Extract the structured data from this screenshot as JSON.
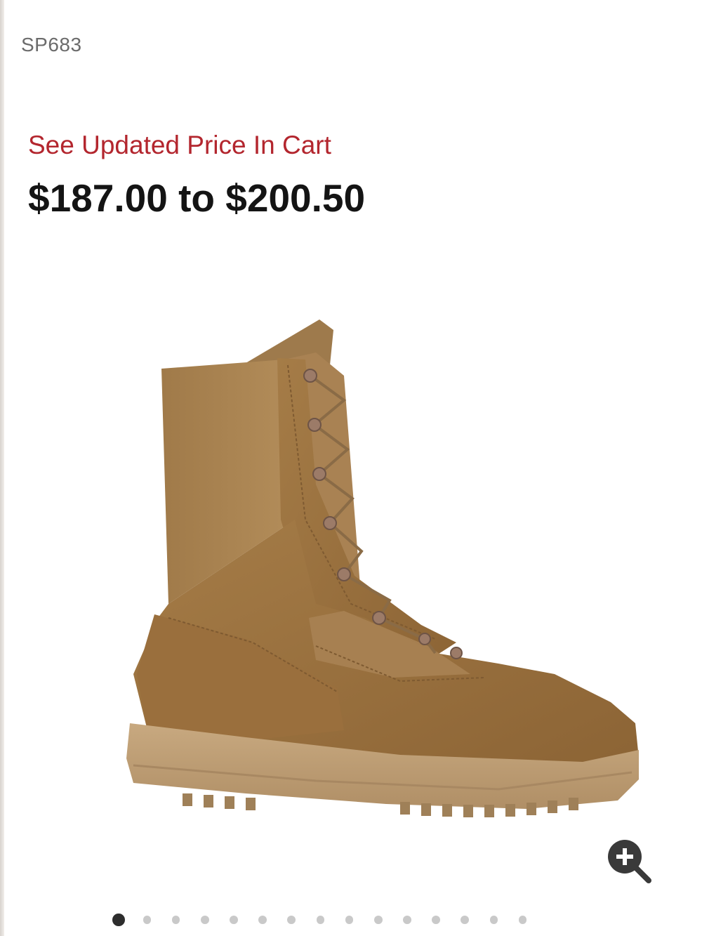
{
  "product": {
    "sku": "SP683",
    "promo_text": "See Updated Price In Cart",
    "price_range": "$187.00 to $200.50",
    "image": {
      "subject": "coyote tan combat boot",
      "colors": {
        "upper_suede": "#9a7240",
        "upper_nylon": "#a98250",
        "sole": "#c4a47c",
        "laces": "#8a6b46",
        "eyelets": "#9c7b68"
      }
    }
  },
  "gallery": {
    "zoom_icon": "zoom-in-icon",
    "dot_count": 15,
    "active_index": 0
  },
  "colors": {
    "accent": "#b3262e",
    "price_text": "#141414"
  }
}
